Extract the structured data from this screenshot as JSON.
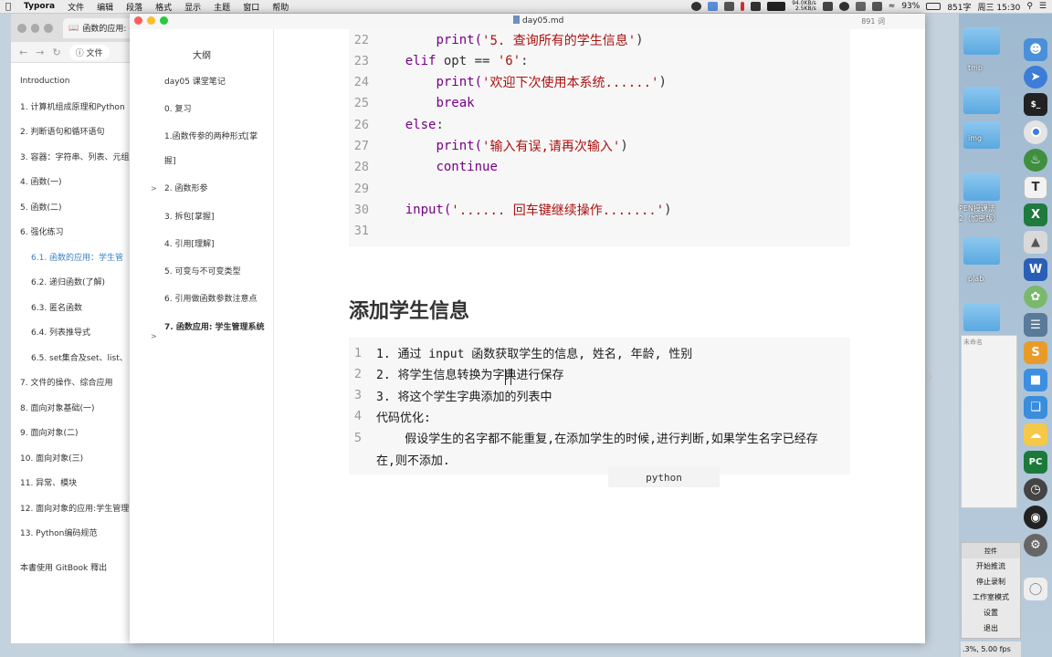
{
  "menubar": {
    "app": "Typora",
    "menus": [
      "文件",
      "编辑",
      "段落",
      "格式",
      "显示",
      "主题",
      "窗口",
      "帮助"
    ],
    "net_up": "94.0KB/s",
    "net_down": "2.5KB/s",
    "battery": "93%",
    "word_status": "851字",
    "clock": "周三 15:30"
  },
  "browser": {
    "tab_title": "函数的应用: 学",
    "address_prefix": "文件",
    "toc": [
      {
        "label": "Introduction",
        "indent": false,
        "active": false
      },
      {
        "label": "1. 计算机组成原理和Python",
        "indent": false,
        "active": false
      },
      {
        "label": "2. 判断语句和循环语句",
        "indent": false,
        "active": false
      },
      {
        "label": "3. 容器：字符串、列表、元组",
        "indent": false,
        "active": false
      },
      {
        "label": "4. 函数(一)",
        "indent": false,
        "active": false
      },
      {
        "label": "5. 函数(二)",
        "indent": false,
        "active": false
      },
      {
        "label": "6. 强化练习",
        "indent": false,
        "active": false
      },
      {
        "label": "6.1. 函数的应用：学生管",
        "indent": true,
        "active": true
      },
      {
        "label": "6.2. 递归函数(了解)",
        "indent": true,
        "active": false
      },
      {
        "label": "6.3. 匿名函数",
        "indent": true,
        "active": false
      },
      {
        "label": "6.4. 列表推导式",
        "indent": true,
        "active": false
      },
      {
        "label": "6.5. set集合及set、list、",
        "indent": true,
        "active": false
      },
      {
        "label": "7. 文件的操作、综合应用",
        "indent": false,
        "active": false
      },
      {
        "label": "8. 面向对象基础(一)",
        "indent": false,
        "active": false
      },
      {
        "label": "9. 面向对象(二)",
        "indent": false,
        "active": false
      },
      {
        "label": "10. 面向对象(三)",
        "indent": false,
        "active": false
      },
      {
        "label": "11. 异常、模块",
        "indent": false,
        "active": false
      },
      {
        "label": "12. 面向对象的应用:学生管理",
        "indent": false,
        "active": false
      },
      {
        "label": "13. Python编码规范",
        "indent": false,
        "active": false
      },
      {
        "label": "本書使用 GitBook 釋出",
        "indent": false,
        "active": false
      }
    ]
  },
  "typora": {
    "file_name": "day05.md",
    "word_count": "891 词",
    "outline_title": "大纲",
    "outline": [
      {
        "label": "day05 课堂笔记",
        "arrow": false
      },
      {
        "label": "0. 复习",
        "arrow": false
      },
      {
        "label": "1.函数传参的两种形式[掌握]",
        "arrow": false
      },
      {
        "label": "2. 函数形参",
        "arrow": true
      },
      {
        "label": "3. 拆包[掌握]",
        "arrow": false
      },
      {
        "label": "4. 引用[理解]",
        "arrow": false
      },
      {
        "label": "5. 可变与不可变类型",
        "arrow": false
      },
      {
        "label": "6. 引用做函数参数注意点",
        "arrow": false
      },
      {
        "label": "7. 函数应用: 学生管理系统",
        "arrow": true,
        "bold": true
      }
    ],
    "code_block_1": [
      {
        "num": "22",
        "indent": "        ",
        "tokens": [
          {
            "t": "print(",
            "c": "kw"
          },
          {
            "t": "'5. 查询所有的学生信息'",
            "c": "st"
          },
          {
            "t": ")",
            "c": "plain"
          }
        ]
      },
      {
        "num": "23",
        "indent": "    ",
        "tokens": [
          {
            "t": "elif",
            "c": "kw"
          },
          {
            "t": " opt == ",
            "c": "plain"
          },
          {
            "t": "'6'",
            "c": "st"
          },
          {
            "t": ":",
            "c": "plain"
          }
        ]
      },
      {
        "num": "24",
        "indent": "        ",
        "tokens": [
          {
            "t": "print(",
            "c": "kw"
          },
          {
            "t": "'欢迎下次使用本系统......'",
            "c": "st"
          },
          {
            "t": ")",
            "c": "plain"
          }
        ]
      },
      {
        "num": "25",
        "indent": "        ",
        "tokens": [
          {
            "t": "break",
            "c": "kw"
          }
        ]
      },
      {
        "num": "26",
        "indent": "    ",
        "tokens": [
          {
            "t": "else",
            "c": "kw"
          },
          {
            "t": ":",
            "c": "plain"
          }
        ]
      },
      {
        "num": "27",
        "indent": "        ",
        "tokens": [
          {
            "t": "print(",
            "c": "kw"
          },
          {
            "t": "'输入有误,请再次输入'",
            "c": "st"
          },
          {
            "t": ")",
            "c": "plain"
          }
        ]
      },
      {
        "num": "28",
        "indent": "        ",
        "tokens": [
          {
            "t": "continue",
            "c": "kw"
          }
        ]
      },
      {
        "num": "29",
        "indent": "",
        "tokens": []
      },
      {
        "num": "30",
        "indent": "    ",
        "tokens": [
          {
            "t": "input(",
            "c": "kw"
          },
          {
            "t": "'...... 回车键继续操作.......'",
            "c": "st"
          },
          {
            "t": ")",
            "c": "plain"
          }
        ]
      },
      {
        "num": "31",
        "indent": "",
        "tokens": []
      }
    ],
    "heading": "添加学生信息",
    "code_block_2": [
      {
        "num": "1",
        "text": "1. 通过 input 函数获取学生的信息, 姓名, 年龄, 性别"
      },
      {
        "num": "2",
        "text": "2. 将学生信息转换为字典进行保存"
      },
      {
        "num": "3",
        "text": "3. 将这个学生字典添加的列表中"
      },
      {
        "num": "4",
        "text": "代码优化:"
      },
      {
        "num": "5",
        "text": "    假设学生的名字都不能重复,在添加学生的时候,进行判断,如果学生名字已经存"
      },
      {
        "num": "",
        "text": "在,则不添加."
      }
    ],
    "language": "python"
  },
  "desktop": {
    "folders": [
      "tmp",
      "img",
      "PEN授课法\n2（加密版）",
      "plab",
      ""
    ],
    "hidden_window_title": "未命名"
  },
  "obs": {
    "header": "控件",
    "buttons": [
      "开始推流",
      "停止录制",
      "工作室模式",
      "设置",
      "退出"
    ],
    "status": ".3%, 5.00 fps"
  },
  "colors": {
    "keyword": "#770088",
    "string": "#aa1111",
    "active_link": "#3b82c4",
    "code_bg": "#f7f7f7"
  }
}
